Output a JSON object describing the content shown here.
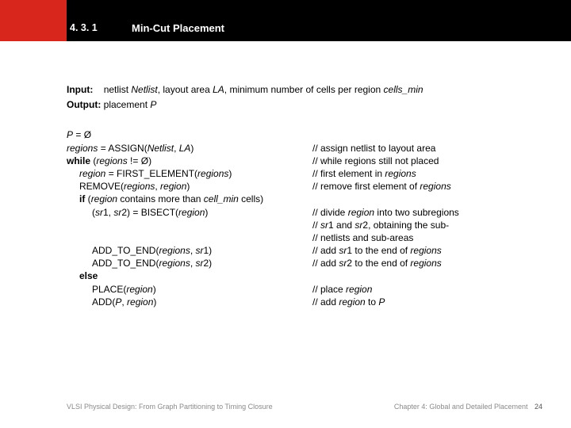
{
  "header": {
    "section_number": "4. 3. 1",
    "title": "Min-Cut Placement"
  },
  "io": {
    "input_label": "Input:",
    "output_label": "Output:",
    "input_r1": "netlist ",
    "input_i1": "Netlist",
    "input_r2": ", layout area ",
    "input_i2": "LA",
    "input_r3": ", minimum number of cells per region ",
    "input_i3": "cells_min",
    "output_r1": "placement ",
    "output_i1": "P"
  },
  "code": {
    "l1a": "P",
    "l1b": " = Ø",
    "l2a": "regions",
    "l2b": " = ASSIGN(",
    "l2c": "Netlist",
    "l2d": ", ",
    "l2e": "LA",
    "l2f": ")",
    "l3a": "while",
    "l3b": " (",
    "l3c": "regions",
    "l3d": " != Ø)",
    "l4a": "region",
    "l4b": " = FIRST_ELEMENT(",
    "l4c": "regions",
    "l4d": ")",
    "l5a": "REMOVE(",
    "l5b": "regions",
    "l5c": ", ",
    "l5d": "region",
    "l5e": ")",
    "l6a": "if",
    "l6b": " (",
    "l6c": "region",
    "l6d": " contains more than ",
    "l6e": "cell_min",
    "l6f": " cells)",
    "l7a": "(",
    "l7b": "sr",
    "l7c": "1, ",
    "l7d": "sr",
    "l7e": "2) = BISECT(",
    "l7f": "region",
    "l7g": ")",
    "l8a": "ADD_TO_END(",
    "l8b": "regions",
    "l8c": ", ",
    "l8d": "sr",
    "l8e": "1)",
    "l9a": "ADD_TO_END(",
    "l9b": "regions",
    "l9c": ", ",
    "l9d": "sr",
    "l9e": "2)",
    "l10a": "else",
    "l11a": "PLACE(",
    "l11b": "region",
    "l11c": ")",
    "l12a": "ADD(",
    "l12b": "P",
    "l12c": ", ",
    "l12d": "region",
    "l12e": ")"
  },
  "comment": {
    "c2": "// assign netlist to layout area",
    "c3": "// while regions still not placed",
    "c4a": "// first element in ",
    "c4b": "regions",
    "c5a": "// remove first element of ",
    "c5b": "regions",
    "c7a": "// divide ",
    "c7b": "region",
    "c7c": " into two subregions",
    "c7d_a": "//   ",
    "c7d_b": "sr",
    "c7d_c": "1 and ",
    "c7d_d": "sr",
    "c7d_e": "2, obtaining the sub-",
    "c7e": "//   netlists and sub-areas",
    "c8a": "// add ",
    "c8b": "sr",
    "c8c": "1 to the end of ",
    "c8d": "regions",
    "c9a": "// add ",
    "c9b": "sr",
    "c9c": "2 to the end of ",
    "c9d": "regions",
    "c11a": "// place ",
    "c11b": "region",
    "c12a": "// add ",
    "c12b": "region",
    "c12c": " to ",
    "c12d": "P"
  },
  "footer": {
    "left": "VLSI Physical Design: From Graph Partitioning to Timing Closure",
    "right": "Chapter 4: Global and Detailed Placement",
    "page": "24"
  }
}
